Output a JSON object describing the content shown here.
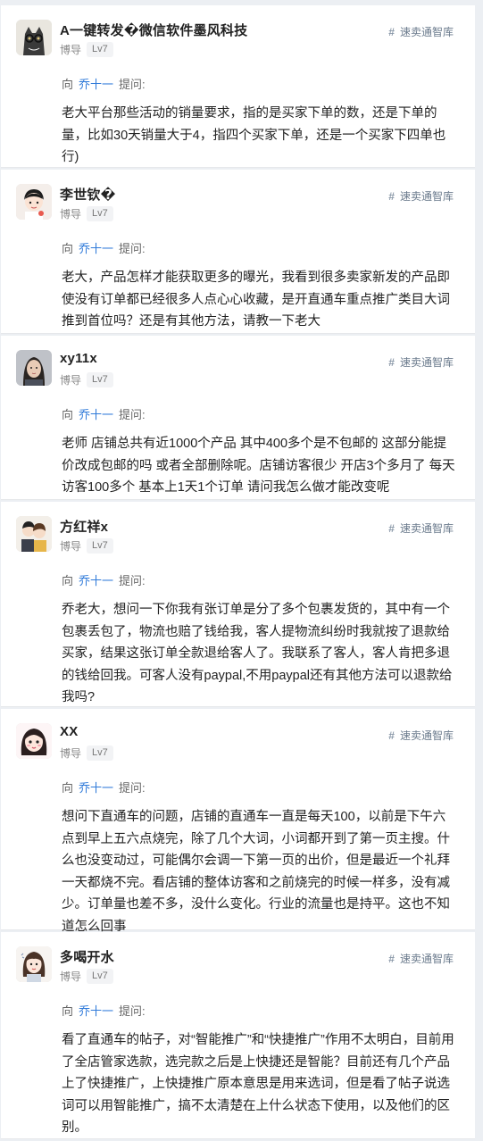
{
  "ask_prefix": "向",
  "ask_suffix": "提问:",
  "tag_icon": "hash-icon",
  "posts": [
    {
      "avatar": "cat-avatar",
      "name": "A一键转发�微信软件墨风科技",
      "role": "博导",
      "level": "Lv7",
      "tag": "速卖通智库",
      "ask_target": "乔十一",
      "text": "老大平台那些活动的销量要求，指的是买家下单的数，还是下单的量，比如30天销量大于4，指四个买家下单，还是一个买家下四单也行)"
    },
    {
      "avatar": "cartoon-boy-avatar",
      "name": "李世钦�",
      "role": "博导",
      "level": "Lv7",
      "tag": "速卖通智库",
      "ask_target": "乔十一",
      "text": "老大，产品怎样才能获取更多的曝光，我看到很多卖家新发的产品即使没有订单都已经很多人点心心收藏，是开直通车重点推广类目大词推到首位吗？还是有其他方法，请教一下老大"
    },
    {
      "avatar": "woman-photo-avatar",
      "name": "xy11x",
      "role": "博导",
      "level": "Lv7",
      "tag": "速卖通智库",
      "ask_target": "乔十一",
      "text": "老师 店铺总共有近1000个产品 其中400多个是不包邮的 这部分能提价改成包邮的吗 或者全部删除呢。店铺访客很少 开店3个多月了 每天访客100多个 基本上1天1个订单 请问我怎么做才能改变呢"
    },
    {
      "avatar": "couple-cartoon-avatar",
      "name": "方红祥x",
      "role": "博导",
      "level": "Lv7",
      "tag": "速卖通智库",
      "ask_target": "乔十一",
      "text": "乔老大，想问一下你我有张订单是分了多个包裹发货的，其中有一个包裹丢包了，物流也赔了钱给我，客人提物流纠纷时我就按了退款给买家，结果这张订单全款退给客人了。我联系了客人，客人肯把多退的钱给回我。可客人没有paypal,不用paypal还有其他方法可以退款给我吗?"
    },
    {
      "avatar": "cartoon-girl-avatar",
      "name": "XX",
      "role": "博导",
      "level": "Lv7",
      "tag": "速卖通智库",
      "ask_target": "乔十一",
      "text": "想问下直通车的问题，店铺的直通车一直是每天100，以前是下午六点到早上五六点烧完，除了几个大词，小词都开到了第一页主搜。什么也没变动过，可能偶尔会调一下第一页的出价，但是最近一个礼拜一天都烧不完。看店铺的整体访客和之前烧完的时候一样多，没有减少。订单量也差不多，没什么变化。行业的流量也是持平。这也不知道怎么回事"
    },
    {
      "avatar": "cartoon-lady-avatar",
      "name": "多喝开水",
      "role": "博导",
      "level": "Lv7",
      "tag": "速卖通智库",
      "ask_target": "乔十一",
      "text": "看了直通车的帖子，对“智能推广”和“快捷推广”作用不太明白，目前用了全店管家选款，选完款之后是上快捷还是智能？目前还有几个产品上了快捷推广，上快捷推广原本意思是用来选词，但是看了帖子说选词可以用智能推广，搞不太清楚在上什么状态下使用，以及他们的区别。"
    }
  ]
}
